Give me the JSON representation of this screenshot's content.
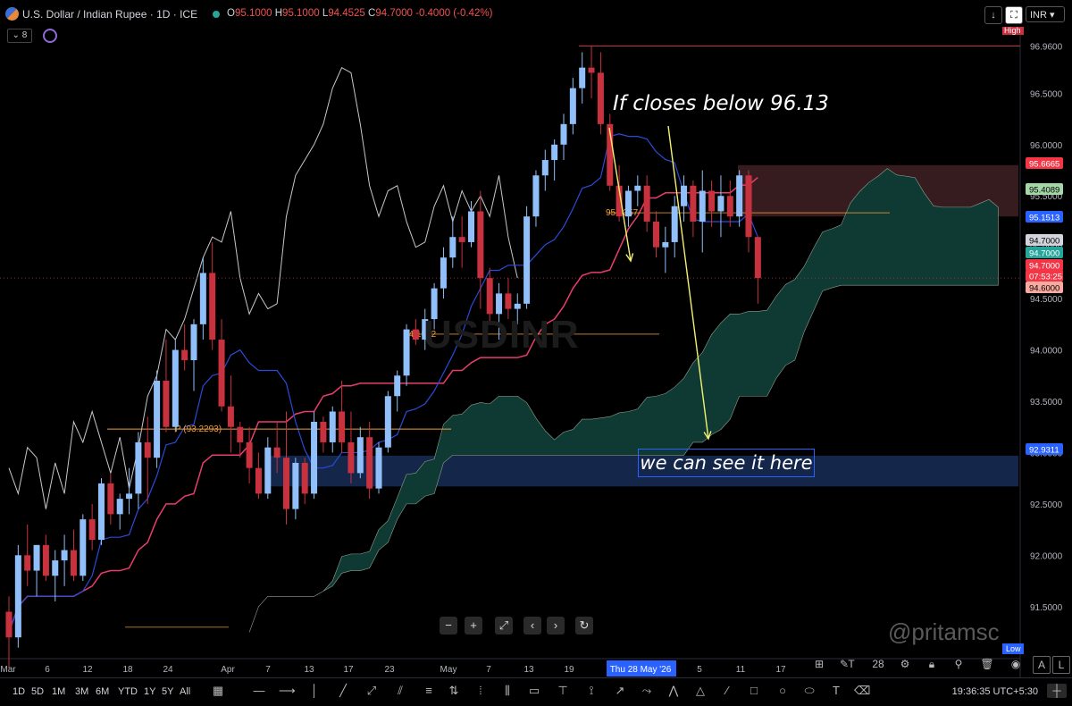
{
  "header": {
    "title": "U.S. Dollar / Indian Rupee · 1D · ICE",
    "ohlc": {
      "o_label": "O",
      "o": "95.1000",
      "h_label": "H",
      "h": "95.1000",
      "l_label": "L",
      "l": "94.4525",
      "c_label": "C",
      "c": "94.7000",
      "change": "-0.4000 (-0.42%)"
    },
    "currency": "INR",
    "indicator_count": "8"
  },
  "annotations": {
    "text1": "If closes below 96.13",
    "text2": "we can see it here",
    "watermark": "USDINR",
    "signature": "@pritamsc",
    "pivot_label": "P (93.2293)",
    "level_label_a": "95.3357",
    "level_label_b": "94.1542"
  },
  "price_axis": {
    "ticks": [
      "96.9600",
      "96.5000",
      "96.0000",
      "95.5000",
      "95.0000",
      "94.5000",
      "94.0000",
      "93.5000",
      "93.0000",
      "92.5000",
      "92.0000",
      "91.5000"
    ],
    "high_label": "High",
    "low_label": "Low",
    "badges": [
      {
        "text": "95.6665",
        "bg": "#f23645",
        "fg": "#ffffff"
      },
      {
        "text": "95.4089",
        "bg": "#a5d6a7",
        "fg": "#000000"
      },
      {
        "text": "95.1513",
        "bg": "#2962ff",
        "fg": "#ffffff"
      },
      {
        "text": "94.7000",
        "bg": "#d1d4dc",
        "fg": "#000000"
      },
      {
        "text": "94.7000",
        "bg": "#26a69a",
        "fg": "#ffffff"
      },
      {
        "text": "94.7000",
        "bg": "#f23645",
        "fg": "#ffffff"
      },
      {
        "text": "07:53:25",
        "bg": "#f23645",
        "fg": "#ffffff"
      },
      {
        "text": "94.6000",
        "bg": "#f8a9a0",
        "fg": "#000000"
      },
      {
        "text": "92.9311",
        "bg": "#2962ff",
        "fg": "#ffffff"
      }
    ]
  },
  "time_axis": {
    "labels": [
      "Mar",
      "6",
      "12",
      "18",
      "24",
      "Apr",
      "7",
      "13",
      "17",
      "23",
      "May",
      "7",
      "13",
      "19",
      "Thu 28 May '26",
      "5",
      "11",
      "17"
    ]
  },
  "bottom_bar": {
    "ranges": [
      "1D",
      "5D",
      "1M",
      "3M",
      "6M",
      "YTD",
      "1Y",
      "5Y",
      "All"
    ],
    "clock": "19:36:35 UTC+5:30"
  },
  "right_toolbar": {
    "zoom_level": "28",
    "a_label": "A",
    "l_label": "L"
  },
  "colors": {
    "bull": "#90bff9",
    "bear": "#c8313e",
    "cloud": "#0f3a33",
    "conversion": "#2a4bd7",
    "base": "#e83e6c",
    "lagging": "#c8c8c8"
  },
  "chart_data": {
    "type": "candlestick",
    "symbol": "USDINR",
    "timeframe": "1D",
    "ylim": [
      91.08,
      97.13
    ],
    "candles": [
      [
        91.45,
        91.6,
        90.9,
        91.2
      ],
      [
        91.2,
        92.1,
        91.1,
        92.0
      ],
      [
        92.0,
        92.3,
        91.7,
        91.85
      ],
      [
        91.85,
        92.1,
        91.6,
        92.1
      ],
      [
        92.1,
        92.2,
        91.75,
        91.8
      ],
      [
        91.8,
        92.05,
        91.55,
        91.95
      ],
      [
        91.95,
        92.2,
        91.7,
        92.05
      ],
      [
        92.05,
        92.25,
        91.75,
        91.8
      ],
      [
        91.8,
        92.4,
        91.75,
        92.35
      ],
      [
        92.35,
        92.5,
        92.05,
        92.15
      ],
      [
        92.15,
        92.75,
        92.1,
        92.7
      ],
      [
        92.7,
        92.8,
        92.3,
        92.4
      ],
      [
        92.4,
        92.6,
        92.25,
        92.55
      ],
      [
        92.55,
        92.85,
        92.4,
        92.6
      ],
      [
        92.6,
        93.2,
        92.45,
        93.1
      ],
      [
        93.1,
        93.35,
        92.5,
        92.95
      ],
      [
        92.95,
        93.8,
        92.85,
        93.7
      ],
      [
        93.7,
        94.1,
        93.2,
        93.25
      ],
      [
        93.25,
        94.1,
        93.2,
        94.0
      ],
      [
        94.0,
        94.25,
        93.8,
        93.9
      ],
      [
        93.9,
        94.3,
        93.6,
        94.25
      ],
      [
        94.25,
        94.9,
        94.1,
        94.75
      ],
      [
        94.75,
        95.05,
        94.0,
        94.1
      ],
      [
        94.1,
        94.3,
        93.4,
        93.45
      ],
      [
        93.45,
        93.75,
        93.0,
        93.25
      ],
      [
        93.25,
        93.3,
        92.95,
        93.1
      ],
      [
        93.1,
        93.25,
        92.7,
        92.85
      ],
      [
        92.85,
        93.0,
        92.55,
        92.6
      ],
      [
        92.6,
        93.15,
        92.55,
        93.05
      ],
      [
        93.05,
        93.3,
        92.8,
        92.95
      ],
      [
        92.95,
        93.4,
        92.3,
        92.45
      ],
      [
        92.45,
        92.95,
        92.35,
        92.9
      ],
      [
        92.9,
        92.95,
        92.5,
        92.6
      ],
      [
        92.6,
        93.4,
        92.55,
        93.3
      ],
      [
        93.3,
        93.35,
        93.0,
        93.1
      ],
      [
        93.1,
        93.45,
        93.0,
        93.4
      ],
      [
        93.4,
        93.7,
        93.0,
        93.1
      ],
      [
        93.1,
        93.4,
        92.7,
        92.8
      ],
      [
        92.8,
        93.25,
        92.75,
        93.15
      ],
      [
        93.15,
        93.3,
        92.55,
        92.65
      ],
      [
        92.65,
        93.1,
        92.6,
        93.05
      ],
      [
        93.05,
        93.6,
        93.0,
        93.55
      ],
      [
        93.55,
        93.8,
        93.4,
        93.75
      ],
      [
        93.75,
        94.25,
        93.65,
        94.2
      ],
      [
        94.2,
        94.3,
        94.05,
        94.1
      ],
      [
        94.1,
        94.4,
        94.0,
        94.3
      ],
      [
        94.3,
        94.65,
        94.2,
        94.6
      ],
      [
        94.6,
        95.0,
        94.5,
        94.9
      ],
      [
        94.9,
        95.3,
        94.8,
        95.1
      ],
      [
        95.1,
        95.3,
        94.8,
        95.05
      ],
      [
        95.05,
        95.45,
        95.0,
        95.35
      ],
      [
        95.35,
        95.55,
        94.4,
        94.7
      ],
      [
        94.7,
        94.8,
        94.25,
        94.35
      ],
      [
        94.35,
        94.65,
        94.1,
        94.55
      ],
      [
        94.55,
        94.7,
        94.3,
        94.4
      ],
      [
        94.4,
        94.55,
        94.25,
        94.45
      ],
      [
        94.45,
        95.4,
        94.4,
        95.3
      ],
      [
        95.3,
        95.75,
        95.2,
        95.7
      ],
      [
        95.7,
        95.95,
        95.55,
        95.85
      ],
      [
        95.85,
        96.05,
        95.65,
        96.0
      ],
      [
        96.0,
        96.3,
        95.85,
        96.2
      ],
      [
        96.2,
        96.65,
        96.1,
        96.55
      ],
      [
        96.55,
        96.9,
        96.4,
        96.75
      ],
      [
        96.75,
        96.96,
        96.45,
        96.7
      ],
      [
        96.7,
        96.9,
        96.1,
        96.2
      ],
      [
        96.2,
        96.3,
        95.55,
        95.6
      ],
      [
        95.6,
        95.8,
        95.25,
        95.3
      ],
      [
        95.3,
        95.6,
        95.2,
        95.55
      ],
      [
        95.55,
        95.7,
        95.4,
        95.6
      ],
      [
        95.6,
        95.7,
        95.15,
        95.25
      ],
      [
        95.25,
        95.35,
        94.9,
        95.0
      ],
      [
        95.0,
        95.2,
        94.75,
        95.05
      ],
      [
        95.05,
        95.5,
        94.9,
        95.4
      ],
      [
        95.4,
        95.7,
        95.25,
        95.6
      ],
      [
        95.6,
        95.65,
        95.1,
        95.25
      ],
      [
        95.25,
        95.75,
        94.95,
        95.55
      ],
      [
        95.55,
        95.65,
        95.2,
        95.35
      ],
      [
        95.35,
        95.7,
        95.1,
        95.5
      ],
      [
        95.5,
        95.65,
        95.2,
        95.3
      ],
      [
        95.3,
        95.75,
        95.2,
        95.7
      ],
      [
        95.7,
        95.75,
        94.95,
        95.1
      ],
      [
        95.1,
        95.1,
        94.45,
        94.7
      ]
    ],
    "levels": [
      {
        "name": "P",
        "value": 93.2293
      },
      {
        "value": 95.3357
      },
      {
        "value": 94.1542
      },
      {
        "value": 96.96
      }
    ],
    "zones": [
      {
        "type": "resistance",
        "from": 95.3,
        "to": 95.8
      },
      {
        "type": "target",
        "from": 92.67,
        "to": 92.97
      }
    ]
  }
}
